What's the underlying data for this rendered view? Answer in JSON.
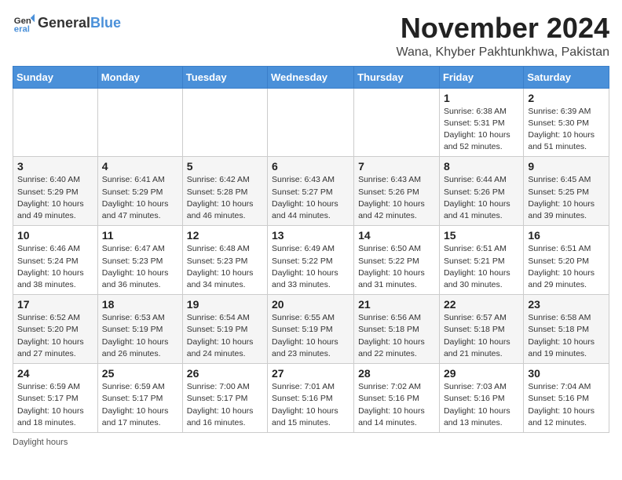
{
  "header": {
    "logo_general": "General",
    "logo_blue": "Blue",
    "month_title": "November 2024",
    "location": "Wana, Khyber Pakhtunkhwa, Pakistan"
  },
  "days_of_week": [
    "Sunday",
    "Monday",
    "Tuesday",
    "Wednesday",
    "Thursday",
    "Friday",
    "Saturday"
  ],
  "weeks": [
    [
      {
        "day": "",
        "info": ""
      },
      {
        "day": "",
        "info": ""
      },
      {
        "day": "",
        "info": ""
      },
      {
        "day": "",
        "info": ""
      },
      {
        "day": "",
        "info": ""
      },
      {
        "day": "1",
        "info": "Sunrise: 6:38 AM\nSunset: 5:31 PM\nDaylight: 10 hours and 52 minutes."
      },
      {
        "day": "2",
        "info": "Sunrise: 6:39 AM\nSunset: 5:30 PM\nDaylight: 10 hours and 51 minutes."
      }
    ],
    [
      {
        "day": "3",
        "info": "Sunrise: 6:40 AM\nSunset: 5:29 PM\nDaylight: 10 hours and 49 minutes."
      },
      {
        "day": "4",
        "info": "Sunrise: 6:41 AM\nSunset: 5:29 PM\nDaylight: 10 hours and 47 minutes."
      },
      {
        "day": "5",
        "info": "Sunrise: 6:42 AM\nSunset: 5:28 PM\nDaylight: 10 hours and 46 minutes."
      },
      {
        "day": "6",
        "info": "Sunrise: 6:43 AM\nSunset: 5:27 PM\nDaylight: 10 hours and 44 minutes."
      },
      {
        "day": "7",
        "info": "Sunrise: 6:43 AM\nSunset: 5:26 PM\nDaylight: 10 hours and 42 minutes."
      },
      {
        "day": "8",
        "info": "Sunrise: 6:44 AM\nSunset: 5:26 PM\nDaylight: 10 hours and 41 minutes."
      },
      {
        "day": "9",
        "info": "Sunrise: 6:45 AM\nSunset: 5:25 PM\nDaylight: 10 hours and 39 minutes."
      }
    ],
    [
      {
        "day": "10",
        "info": "Sunrise: 6:46 AM\nSunset: 5:24 PM\nDaylight: 10 hours and 38 minutes."
      },
      {
        "day": "11",
        "info": "Sunrise: 6:47 AM\nSunset: 5:23 PM\nDaylight: 10 hours and 36 minutes."
      },
      {
        "day": "12",
        "info": "Sunrise: 6:48 AM\nSunset: 5:23 PM\nDaylight: 10 hours and 34 minutes."
      },
      {
        "day": "13",
        "info": "Sunrise: 6:49 AM\nSunset: 5:22 PM\nDaylight: 10 hours and 33 minutes."
      },
      {
        "day": "14",
        "info": "Sunrise: 6:50 AM\nSunset: 5:22 PM\nDaylight: 10 hours and 31 minutes."
      },
      {
        "day": "15",
        "info": "Sunrise: 6:51 AM\nSunset: 5:21 PM\nDaylight: 10 hours and 30 minutes."
      },
      {
        "day": "16",
        "info": "Sunrise: 6:51 AM\nSunset: 5:20 PM\nDaylight: 10 hours and 29 minutes."
      }
    ],
    [
      {
        "day": "17",
        "info": "Sunrise: 6:52 AM\nSunset: 5:20 PM\nDaylight: 10 hours and 27 minutes."
      },
      {
        "day": "18",
        "info": "Sunrise: 6:53 AM\nSunset: 5:19 PM\nDaylight: 10 hours and 26 minutes."
      },
      {
        "day": "19",
        "info": "Sunrise: 6:54 AM\nSunset: 5:19 PM\nDaylight: 10 hours and 24 minutes."
      },
      {
        "day": "20",
        "info": "Sunrise: 6:55 AM\nSunset: 5:19 PM\nDaylight: 10 hours and 23 minutes."
      },
      {
        "day": "21",
        "info": "Sunrise: 6:56 AM\nSunset: 5:18 PM\nDaylight: 10 hours and 22 minutes."
      },
      {
        "day": "22",
        "info": "Sunrise: 6:57 AM\nSunset: 5:18 PM\nDaylight: 10 hours and 21 minutes."
      },
      {
        "day": "23",
        "info": "Sunrise: 6:58 AM\nSunset: 5:18 PM\nDaylight: 10 hours and 19 minutes."
      }
    ],
    [
      {
        "day": "24",
        "info": "Sunrise: 6:59 AM\nSunset: 5:17 PM\nDaylight: 10 hours and 18 minutes."
      },
      {
        "day": "25",
        "info": "Sunrise: 6:59 AM\nSunset: 5:17 PM\nDaylight: 10 hours and 17 minutes."
      },
      {
        "day": "26",
        "info": "Sunrise: 7:00 AM\nSunset: 5:17 PM\nDaylight: 10 hours and 16 minutes."
      },
      {
        "day": "27",
        "info": "Sunrise: 7:01 AM\nSunset: 5:16 PM\nDaylight: 10 hours and 15 minutes."
      },
      {
        "day": "28",
        "info": "Sunrise: 7:02 AM\nSunset: 5:16 PM\nDaylight: 10 hours and 14 minutes."
      },
      {
        "day": "29",
        "info": "Sunrise: 7:03 AM\nSunset: 5:16 PM\nDaylight: 10 hours and 13 minutes."
      },
      {
        "day": "30",
        "info": "Sunrise: 7:04 AM\nSunset: 5:16 PM\nDaylight: 10 hours and 12 minutes."
      }
    ]
  ],
  "footer": {
    "note": "Daylight hours"
  }
}
